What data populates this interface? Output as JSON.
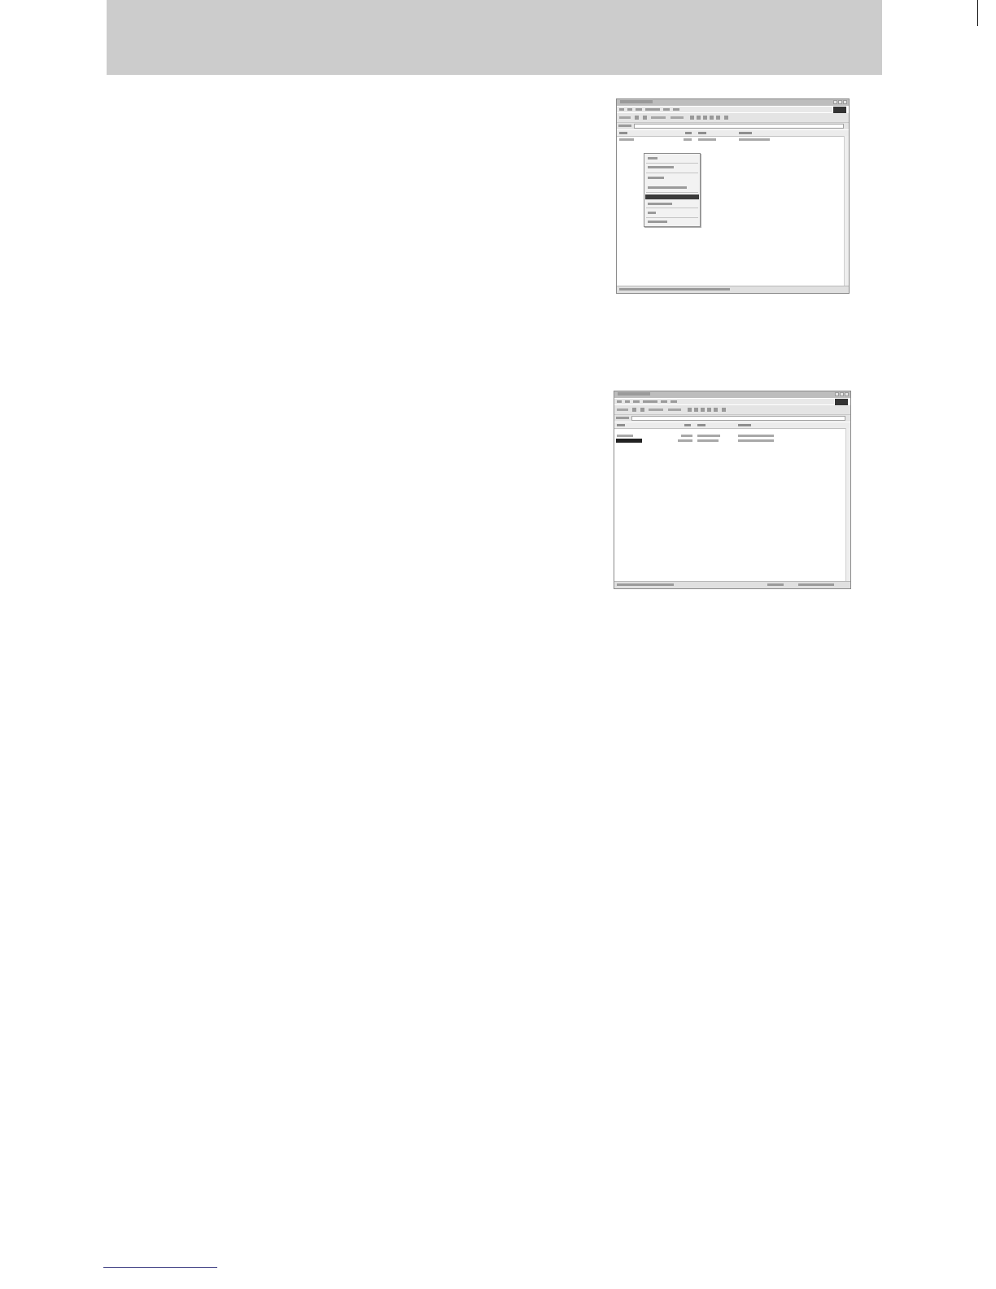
{
  "page": {
    "background": "#ffffff",
    "header_band_color": "#cccccc"
  },
  "screenshots": [
    {
      "id": "screenshot-context-menu",
      "description_visible_text": [],
      "has_context_menu": true,
      "selected_menu_index": 5
    },
    {
      "id": "screenshot-file-list",
      "description_visible_text": [],
      "rows": 2,
      "selected_row_index": 1
    }
  ]
}
